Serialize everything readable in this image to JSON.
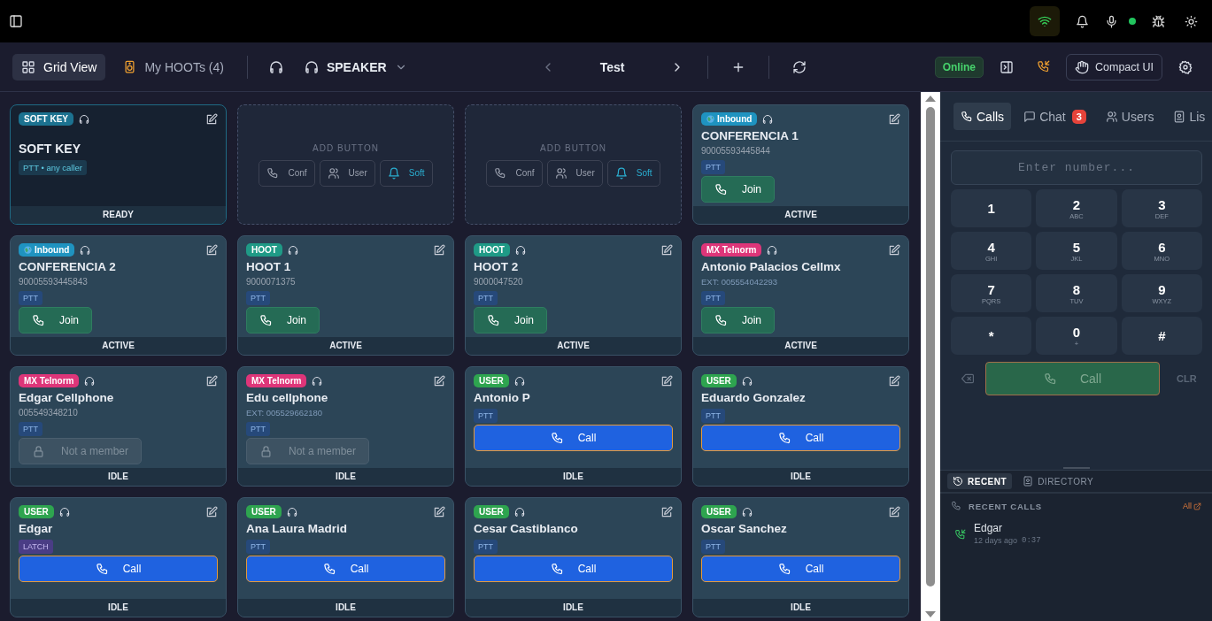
{
  "toolbar": {
    "tabs": [
      {
        "label": "Grid View",
        "selected": true
      },
      {
        "label": "My HOOTs (4)",
        "selected": false
      }
    ],
    "audio_output": "SPEAKER",
    "page_title": "Test",
    "connection": "Online",
    "compact_button": "Compact UI"
  },
  "cards": [
    {
      "kind": "softkey",
      "badge": {
        "text": "SOFT KEY",
        "color": "#1c7290"
      },
      "title": "SOFT KEY",
      "tag": {
        "text": "PTT • any caller",
        "kind": "caller"
      },
      "status": "READY"
    },
    {
      "kind": "add",
      "label": "ADD BUTTON",
      "options": [
        "Conf",
        "User",
        "Soft"
      ]
    },
    {
      "kind": "add",
      "label": "ADD BUTTON",
      "options": [
        "Conf",
        "User",
        "Soft"
      ]
    },
    {
      "kind": "contact",
      "badge": {
        "text": "Inbound",
        "color": "#1f93c0",
        "globe": true
      },
      "title": "CONFERENCIA 1",
      "number": "90005593445844",
      "ext": false,
      "tag": {
        "text": "PTT",
        "kind": "ptt"
      },
      "action": {
        "kind": "join",
        "label": "Join"
      },
      "status": "ACTIVE"
    },
    {
      "kind": "contact",
      "badge": {
        "text": "Inbound",
        "color": "#1f93c0",
        "globe": true
      },
      "title": "CONFERENCIA 2",
      "number": "90005593445843",
      "ext": false,
      "tag": {
        "text": "PTT",
        "kind": "ptt"
      },
      "action": {
        "kind": "join",
        "label": "Join"
      },
      "status": "ACTIVE"
    },
    {
      "kind": "contact",
      "badge": {
        "text": "HOOT",
        "color": "#1f9a86"
      },
      "title": "HOOT 1",
      "number": "9000071375",
      "ext": false,
      "tag": {
        "text": "PTT",
        "kind": "ptt"
      },
      "action": {
        "kind": "join",
        "label": "Join"
      },
      "status": "ACTIVE"
    },
    {
      "kind": "contact",
      "badge": {
        "text": "HOOT",
        "color": "#1f9a86"
      },
      "title": "HOOT 2",
      "number": "9000047520",
      "ext": false,
      "tag": {
        "text": "PTT",
        "kind": "ptt"
      },
      "action": {
        "kind": "join",
        "label": "Join"
      },
      "status": "ACTIVE"
    },
    {
      "kind": "contact",
      "badge": {
        "text": "MX Telnorm",
        "color": "#de3579"
      },
      "title": "Antonio Palacios Cellmx",
      "number": "EXT: 005554042293",
      "ext": true,
      "tag": {
        "text": "PTT",
        "kind": "ptt"
      },
      "action": {
        "kind": "join",
        "label": "Join"
      },
      "status": "ACTIVE"
    },
    {
      "kind": "contact",
      "badge": {
        "text": "MX Telnorm",
        "color": "#de3579"
      },
      "title": "Edgar Cellphone",
      "number": "005549348210",
      "ext": false,
      "tag": {
        "text": "PTT",
        "kind": "ptt"
      },
      "action": {
        "kind": "locked",
        "label": "Not a member"
      },
      "status": "IDLE"
    },
    {
      "kind": "contact",
      "badge": {
        "text": "MX Telnorm",
        "color": "#de3579"
      },
      "title": "Edu cellphone",
      "number": "EXT: 005529662180",
      "ext": true,
      "tag": {
        "text": "PTT",
        "kind": "ptt"
      },
      "action": {
        "kind": "locked",
        "label": "Not a member"
      },
      "status": "IDLE"
    },
    {
      "kind": "contact",
      "badge": {
        "text": "USER",
        "color": "#2ea44f"
      },
      "title": "Antonio P",
      "tag": {
        "text": "PTT",
        "kind": "ptt"
      },
      "action": {
        "kind": "call",
        "label": "Call"
      },
      "status": "IDLE"
    },
    {
      "kind": "contact",
      "badge": {
        "text": "USER",
        "color": "#2ea44f"
      },
      "title": "Eduardo Gonzalez",
      "tag": {
        "text": "PTT",
        "kind": "ptt"
      },
      "action": {
        "kind": "call",
        "label": "Call"
      },
      "status": "IDLE"
    },
    {
      "kind": "contact",
      "badge": {
        "text": "USER",
        "color": "#2ea44f"
      },
      "title": "Edgar",
      "tag": {
        "text": "LATCH",
        "kind": "latch"
      },
      "action": {
        "kind": "call",
        "label": "Call"
      },
      "status": "IDLE"
    },
    {
      "kind": "contact",
      "badge": {
        "text": "USER",
        "color": "#2ea44f"
      },
      "title": "Ana Laura Madrid",
      "tag": {
        "text": "PTT",
        "kind": "ptt"
      },
      "action": {
        "kind": "call",
        "label": "Call"
      },
      "status": "IDLE"
    },
    {
      "kind": "contact",
      "badge": {
        "text": "USER",
        "color": "#2ea44f"
      },
      "title": "Cesar Castiblanco",
      "tag": {
        "text": "PTT",
        "kind": "ptt"
      },
      "action": {
        "kind": "call",
        "label": "Call"
      },
      "status": "IDLE"
    },
    {
      "kind": "contact",
      "badge": {
        "text": "USER",
        "color": "#2ea44f"
      },
      "title": "Oscar Sanchez",
      "tag": {
        "text": "PTT",
        "kind": "ptt"
      },
      "action": {
        "kind": "call",
        "label": "Call"
      },
      "status": "IDLE"
    }
  ],
  "side_panel": {
    "tabs": [
      {
        "label": "Calls",
        "selected": true
      },
      {
        "label": "Chat",
        "badge": "3",
        "selected": false
      },
      {
        "label": "Users",
        "selected": false
      },
      {
        "label": "Lis",
        "selected": false
      }
    ],
    "dialer": {
      "placeholder": "Enter number...",
      "keys": [
        {
          "digit": "1"
        },
        {
          "digit": "2",
          "letters": "ABC"
        },
        {
          "digit": "3",
          "letters": "DEF"
        },
        {
          "digit": "4",
          "letters": "GHI"
        },
        {
          "digit": "5",
          "letters": "JKL"
        },
        {
          "digit": "6",
          "letters": "MNO"
        },
        {
          "digit": "7",
          "letters": "PQRS"
        },
        {
          "digit": "8",
          "letters": "TUV"
        },
        {
          "digit": "9",
          "letters": "WXYZ"
        },
        {
          "digit": "*"
        },
        {
          "digit": "0",
          "letters": "+"
        },
        {
          "digit": "#"
        }
      ],
      "call_button": "Call",
      "clear_button": "CLR"
    },
    "bottom_tabs": [
      {
        "label": "RECENT",
        "selected": true
      },
      {
        "label": "DIRECTORY",
        "selected": false
      }
    ],
    "recent_title": "RECENT CALLS",
    "all_link": "All",
    "recent_calls": [
      {
        "name": "Edgar",
        "when": "12 days ago",
        "duration": "0:37"
      }
    ]
  }
}
